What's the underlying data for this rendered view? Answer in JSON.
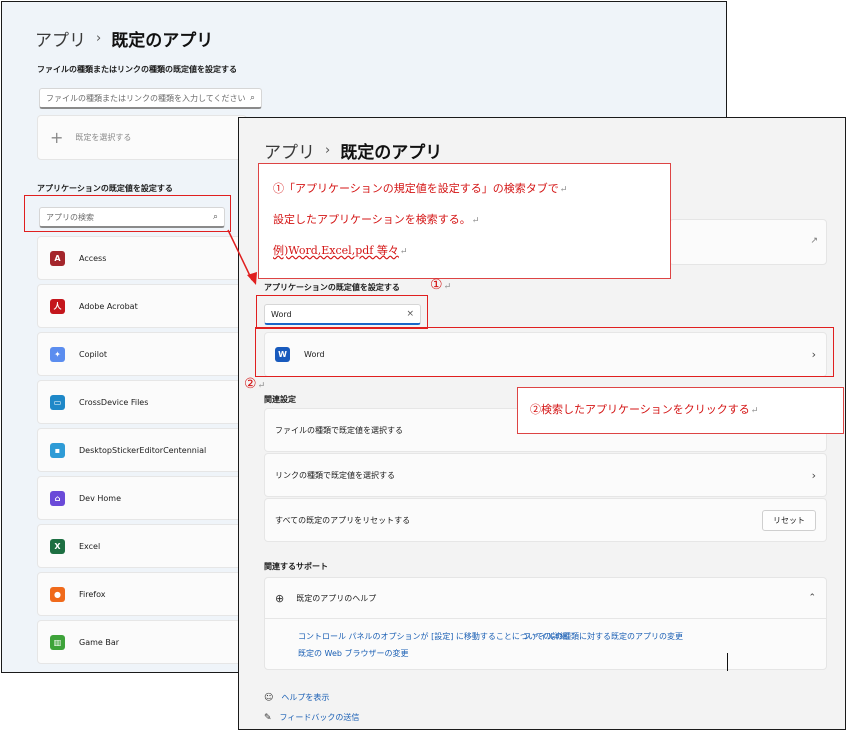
{
  "back_window": {
    "breadcrumb": {
      "parent": "アプリ",
      "separator": "›",
      "current": "既定のアプリ"
    },
    "filetype_section": {
      "label": "ファイルの種類またはリンクの種類の既定値を設定する",
      "search_placeholder": "ファイルの種類またはリンクの種類を入力してください",
      "choose_default": "既定を選択する"
    },
    "app_section": {
      "label": "アプリケーションの既定値を設定する",
      "search_placeholder": "アプリの検索"
    },
    "apps": [
      {
        "name": "Access",
        "icon": "access-icon",
        "color": "#a4262c",
        "glyph": "A"
      },
      {
        "name": "Adobe Acrobat",
        "icon": "adobe-acrobat-icon",
        "color": "#c4161c",
        "glyph": "人"
      },
      {
        "name": "Copilot",
        "icon": "copilot-icon",
        "color": "#5b8def",
        "glyph": "✦"
      },
      {
        "name": "CrossDevice Files",
        "icon": "crossdevice-icon",
        "color": "#1e88c8",
        "glyph": "▭"
      },
      {
        "name": "DesktopStickerEditorCentennial",
        "icon": "sticker-editor-icon",
        "color": "#2e9bd6",
        "glyph": "▪"
      },
      {
        "name": "Dev Home",
        "icon": "dev-home-icon",
        "color": "#6a4ad8",
        "glyph": "⌂"
      },
      {
        "name": "Excel",
        "icon": "excel-icon",
        "color": "#1d6f42",
        "glyph": "X"
      },
      {
        "name": "Firefox",
        "icon": "firefox-icon",
        "color": "#f06a1b",
        "glyph": "●"
      },
      {
        "name": "Game Bar",
        "icon": "game-bar-icon",
        "color": "#3ea33a",
        "glyph": "▥"
      }
    ]
  },
  "front_window": {
    "breadcrumb": {
      "parent": "アプリ",
      "separator": "›",
      "current": "既定のアプリ"
    },
    "app_section_label": "アプリケーションの既定値を設定する",
    "search_value": "Word",
    "clear_glyph": "×",
    "result": {
      "name": "Word",
      "icon": "word-icon",
      "color": "#185abd",
      "glyph": "W"
    },
    "related_settings": {
      "title": "関連設定",
      "items": [
        {
          "label": "ファイルの種類で既定値を選択する"
        },
        {
          "label": "リンクの種類で既定値を選択する"
        },
        {
          "label": "すべての既定のアプリをリセットする",
          "button": "リセット"
        }
      ]
    },
    "related_support": {
      "title": "関連するサポート",
      "help_title": "既定のアプリのヘルプ",
      "links": [
        "コントロール パネルのオプションが [設定] に移動することについての詳細",
        "ファイルの種類に対する既定のアプリの変更",
        "既定の Web ブラウザーの変更"
      ]
    },
    "footer": {
      "help": "ヘルプを表示",
      "feedback": "フィードバックの送信"
    }
  },
  "annotations": {
    "note1_lines": [
      "①「アプリケーションの規定値を設定する」の検索タブで",
      "設定したアプリケーションを検索する。",
      "例)Word,Excel,pdf 等々"
    ],
    "note2": "②検索したアプリケーションをクリックする",
    "marker1": "①",
    "marker2": "②",
    "return_mark": "↵",
    "accent_color": "#e01f1f"
  }
}
